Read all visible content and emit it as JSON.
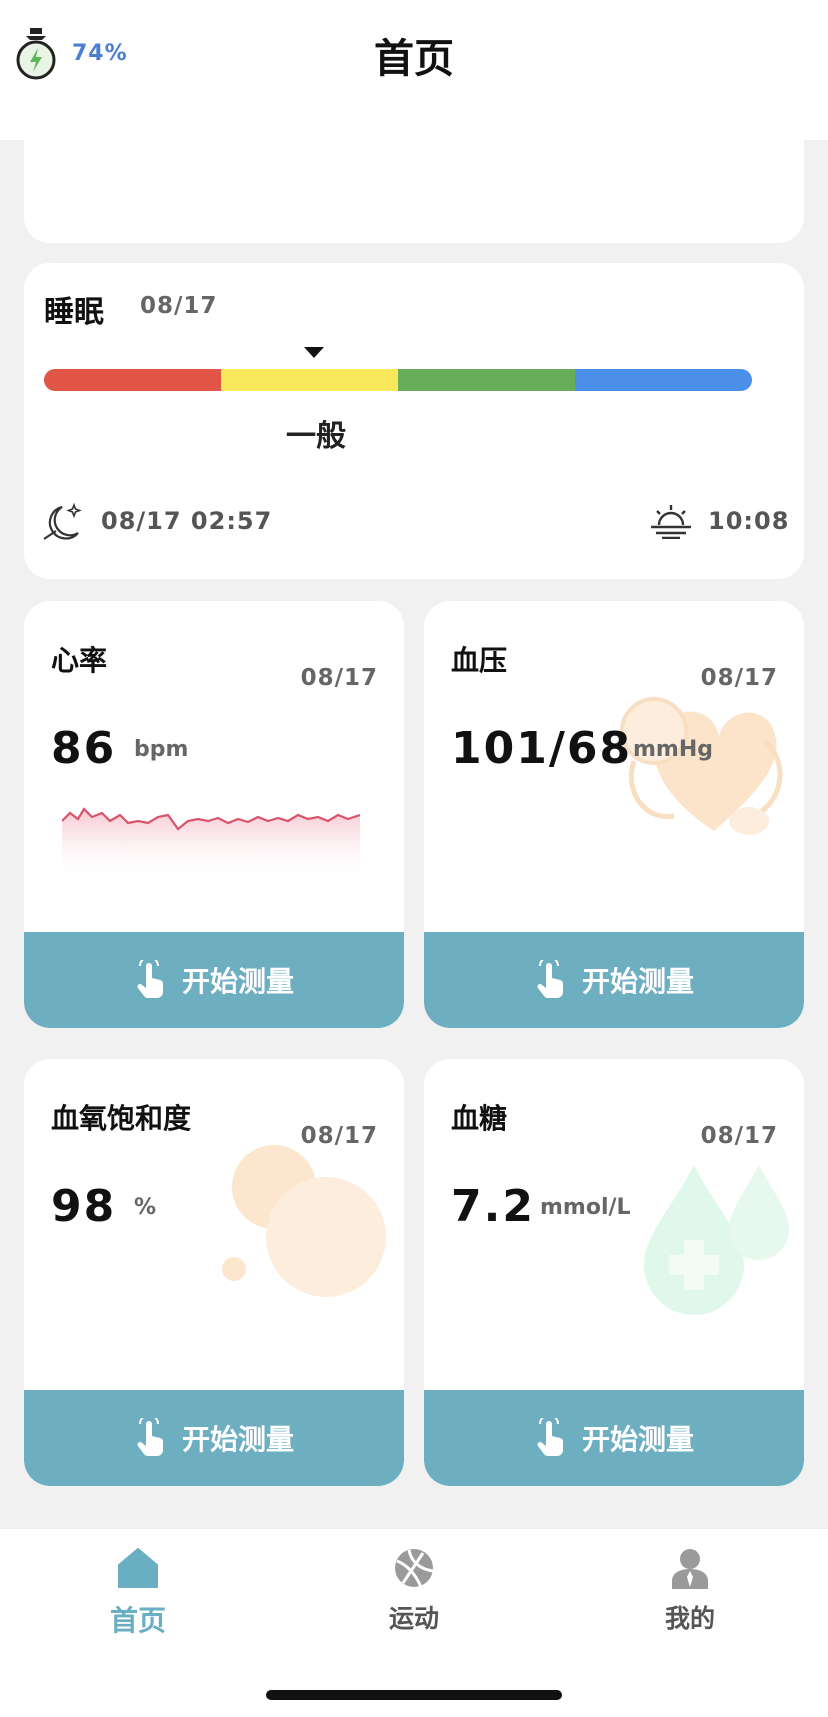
{
  "header": {
    "battery_percent": "74%",
    "title": "首页"
  },
  "sleep": {
    "title": "睡眠",
    "date": "08/17",
    "quality": "一般",
    "quality_levels_colors": [
      "#e05545",
      "#f8e85c",
      "#67ad5b",
      "#4c8fe8"
    ],
    "sleep_start": "08/17 02:57",
    "wake_time": "10:08"
  },
  "metrics": [
    {
      "title": "心率",
      "date": "08/17",
      "value": "86",
      "unit": "bpm",
      "button": "开始测量"
    },
    {
      "title": "血压",
      "date": "08/17",
      "value": "101/68",
      "unit": "mmHg",
      "button": "开始测量"
    },
    {
      "title": "血氧饱和度",
      "date": "08/17",
      "value": "98",
      "unit": "%",
      "button": "开始测量"
    },
    {
      "title": "血糖",
      "date": "08/17",
      "value": "7.2",
      "unit": "mmol/L",
      "button": "开始测量"
    }
  ],
  "nav": {
    "home": "首页",
    "sport": "运动",
    "me": "我的"
  },
  "colors": {
    "accent": "#6daec0",
    "battery_text": "#4a7fd0"
  }
}
